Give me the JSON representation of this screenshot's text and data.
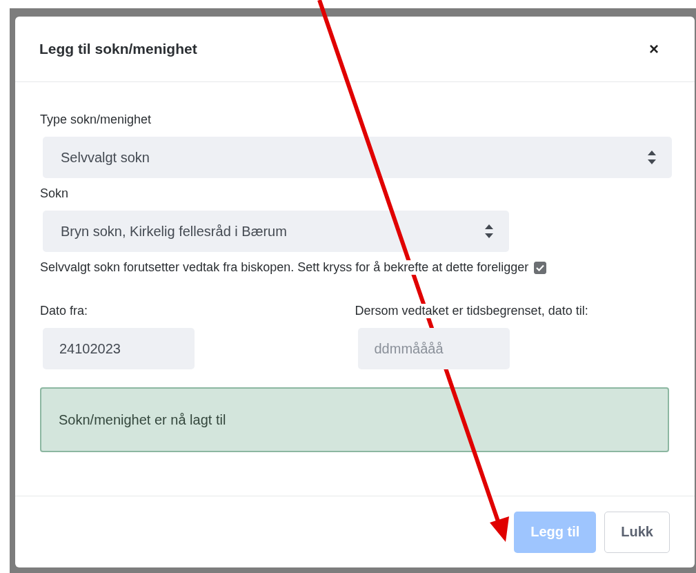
{
  "dialog": {
    "title": "Legg til sokn/menighet",
    "close": "×"
  },
  "fields": [
    {
      "kind": "select",
      "label": "Type sokn/menighet",
      "value": "Selvvalgt sokn",
      "wide": true
    },
    {
      "kind": "select",
      "label": "Sokn",
      "value": "Bryn sokn, Kirkelig fellesråd i Bærum",
      "wide": false
    }
  ],
  "confirmation": {
    "text": "Selvvalgt sokn forutsetter vedtak fra biskopen. Sett kryss for å bekrefte at dette foreligger",
    "checked": true
  },
  "dates": [
    {
      "label": "Dato fra:",
      "value": "24102023"
    },
    {
      "label": "Dersom vedtaket er tidsbegrenset, dato til:",
      "placeholder": "ddmmåååå"
    }
  ],
  "alert": {
    "text": "Sokn/menighet er nå lagt til"
  },
  "buttons": [
    {
      "label": "Legg til",
      "kind": "primary",
      "disabled": true
    },
    {
      "label": "Lukk",
      "kind": "secondary",
      "disabled": false
    }
  ],
  "annotation": {
    "kind": "arrow"
  }
}
